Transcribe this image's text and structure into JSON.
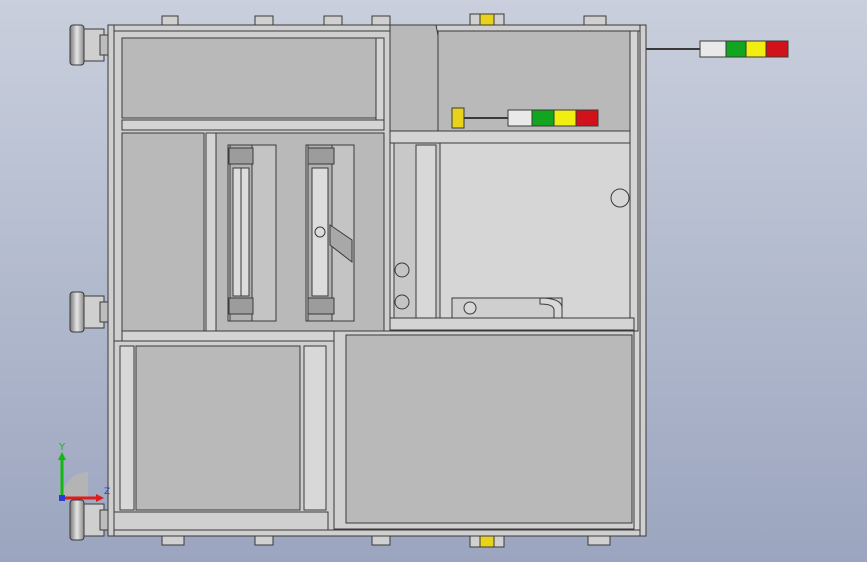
{
  "viewport": {
    "background_top": "#c9cfdc",
    "background_bottom": "#9ba5bf"
  },
  "colors": {
    "panel_fill": "#b9b9b9",
    "frame_fill": "#d6d6d6",
    "line": "#3a3a3a",
    "signal_green": "#12a51f",
    "signal_yellow": "#f1ee12",
    "signal_red": "#d2121a",
    "signal_white": "#e9e9e9",
    "sensor_yellow": "#e8d21a",
    "axis_y": "#14b814",
    "axis_x": "#e01c1c",
    "axis_z": "#2a3cd4"
  },
  "icons": {
    "caster_wheel": "caster-wheel-icon",
    "signal_tower": "signal-tower-icon",
    "axis_triad": "axis-triad-icon"
  },
  "triad": {
    "y_label": "Y",
    "z_label": "Z"
  }
}
